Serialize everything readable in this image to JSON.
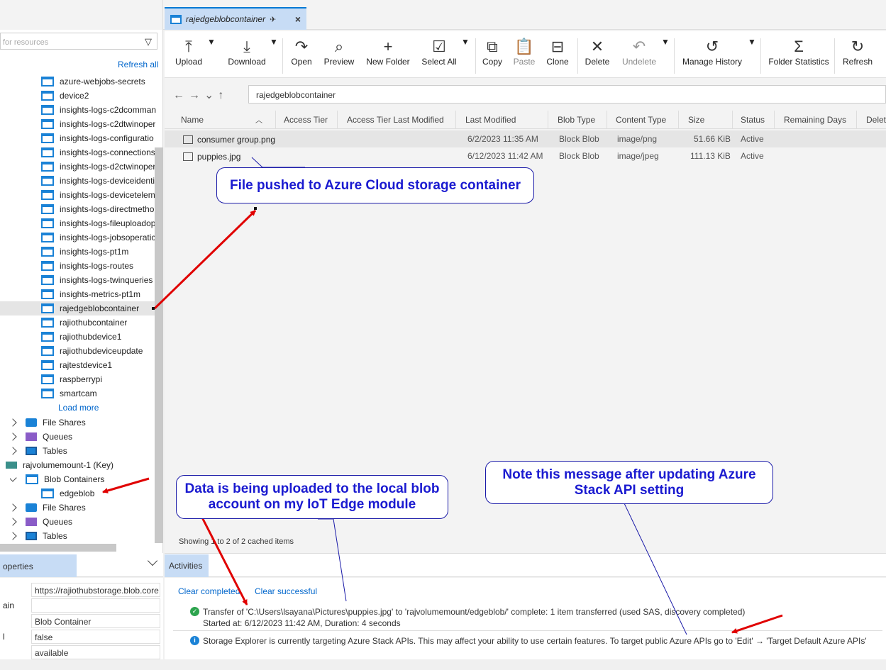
{
  "tab": {
    "title": "rajedgeblobcontainer",
    "close": "×"
  },
  "left": {
    "search_placeholder": "for resources",
    "refresh_all": "Refresh all",
    "containers": [
      "azure-webjobs-secrets",
      "device2",
      "insights-logs-c2dcomman",
      "insights-logs-c2dtwinoper",
      "insights-logs-configuratio",
      "insights-logs-connections",
      "insights-logs-d2ctwinoper",
      "insights-logs-deviceidenti",
      "insights-logs-devicetelem",
      "insights-logs-directmetho",
      "insights-logs-fileuploadop",
      "insights-logs-jobsoperatic",
      "insights-logs-pt1m",
      "insights-logs-routes",
      "insights-logs-twinqueries",
      "insights-metrics-pt1m",
      "rajedgeblobcontainer",
      "rajiothubcontainer",
      "rajiothubdevice1",
      "rajiothubdeviceupdate",
      "rajtestdevice1",
      "raspberrypi",
      "smartcam"
    ],
    "load_more": "Load more",
    "file_shares": "File Shares",
    "queues": "Queues",
    "tables": "Tables",
    "account2": "rajvolumemount-1 (Key)",
    "blob_containers": "Blob Containers",
    "edgeblob": "edgeblob",
    "file_shares2": "File Shares",
    "queues2": "Queues",
    "tables2": "Tables"
  },
  "properties": {
    "tab": "operties",
    "rows": [
      {
        "key": "",
        "value": "https://rajiothubstorage.blob.core"
      },
      {
        "key": "ain",
        "value": ""
      },
      {
        "key": "",
        "value": "Blob Container"
      },
      {
        "key": "l",
        "value": "false"
      },
      {
        "key": "",
        "value": "available"
      }
    ]
  },
  "toolbar": {
    "upload": "Upload",
    "download": "Download",
    "open": "Open",
    "preview": "Preview",
    "new_folder": "New Folder",
    "select_all": "Select All",
    "copy": "Copy",
    "paste": "Paste",
    "clone": "Clone",
    "delete": "Delete",
    "undelete": "Undelete",
    "manage_history": "Manage History",
    "folder_statistics": "Folder Statistics",
    "refresh": "Refresh"
  },
  "path": "rajedgeblobcontainer",
  "columns": [
    "Name",
    "Access Tier",
    "Access Tier Last Modified",
    "Last Modified",
    "Blob Type",
    "Content Type",
    "Size",
    "Status",
    "Remaining Days",
    "Delet"
  ],
  "rows": [
    {
      "name": "consumer group.png",
      "modified": "6/2/2023 11:35 AM",
      "type": "Block Blob",
      "content": "image/png",
      "size": "51.66 KiB",
      "status": "Active"
    },
    {
      "name": "puppies.jpg",
      "modified": "6/12/2023 11:42 AM",
      "type": "Block Blob",
      "content": "image/jpeg",
      "size": "111.13 KiB",
      "status": "Active"
    }
  ],
  "showing": "Showing 1 to 2 of 2 cached items",
  "activities": {
    "tab": "Activities",
    "clear_completed": "Clear completed",
    "clear_successful": "Clear successful",
    "transfer_line1": "Transfer of 'C:\\Users\\lsayana\\Pictures\\puppies.jpg' to 'rajvolumemount/edgeblob/' complete: 1 item transferred (used SAS, discovery completed)",
    "transfer_line2": "Started at: 6/12/2023 11:42 AM, Duration: 4 seconds",
    "info_line": "Storage Explorer is currently targeting Azure Stack APIs. This may affect your ability to use certain features. To target public Azure APIs go to 'Edit' → 'Target Default Azure APIs'"
  },
  "callouts": {
    "pushed": "File pushed to Azure Cloud storage container",
    "uploaded": "Data is being uploaded to the local blob account on my IoT Edge module",
    "note": "Note this message after updating Azure Stack API setting"
  },
  "colors": {
    "accent": "#0078d4",
    "tab_bg": "#c7dcf5",
    "callout_text": "#1a1ad0",
    "arrow": "#e00000"
  }
}
